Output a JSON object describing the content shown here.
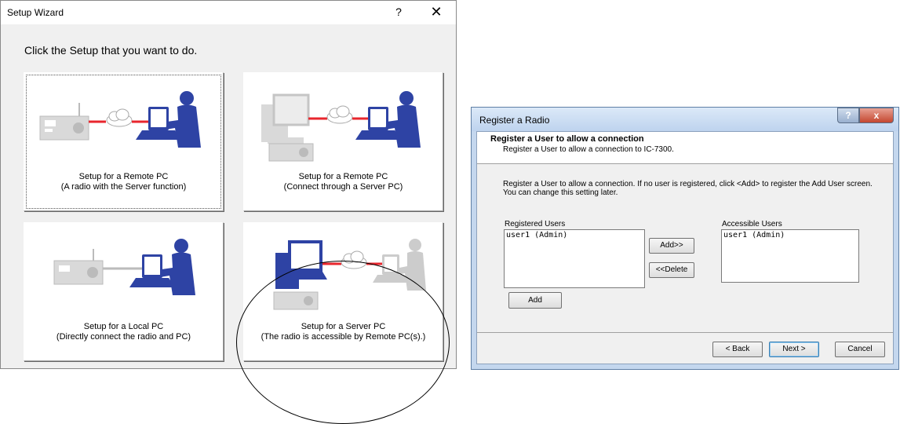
{
  "wizard": {
    "title": "Setup Wizard",
    "help": "?",
    "close": "✕",
    "prompt": "Click the Setup that you want to do.",
    "tiles": [
      {
        "line1": "Setup for a Remote PC",
        "line2": "(A radio with the Server function)"
      },
      {
        "line1": "Setup for a Remote PC",
        "line2": "(Connect through a Server PC)"
      },
      {
        "line1": "Setup for a Local PC",
        "line2": "(Directly connect the radio and PC)"
      },
      {
        "line1": "Setup for a Server PC",
        "line2": "(The radio is accessible by Remote PC(s).)"
      }
    ]
  },
  "register": {
    "title": "Register a Radio",
    "help": "?",
    "close": "x",
    "header_title": "Register a User to allow a connection",
    "header_sub": "Register a User to allow a connection to IC-7300.",
    "description": "Register a User to allow a connection. If no user is registered, click <Add> to register the Add User screen. You can change this setting later.",
    "registered_label": "Registered Users",
    "registered_users": [
      "user1 (Admin)"
    ],
    "accessible_label": "Accessible Users",
    "accessible_users": [
      "user1 (Admin)"
    ],
    "add_to_button": "Add>>",
    "delete_button": "<<Delete",
    "add_button": "Add",
    "back_button": "< Back",
    "next_button": "Next >",
    "cancel_button": "Cancel"
  },
  "colors": {
    "icon_blue": "#2e43a4",
    "link_red": "#e8262d",
    "disabled_gray": "#cccccc"
  }
}
